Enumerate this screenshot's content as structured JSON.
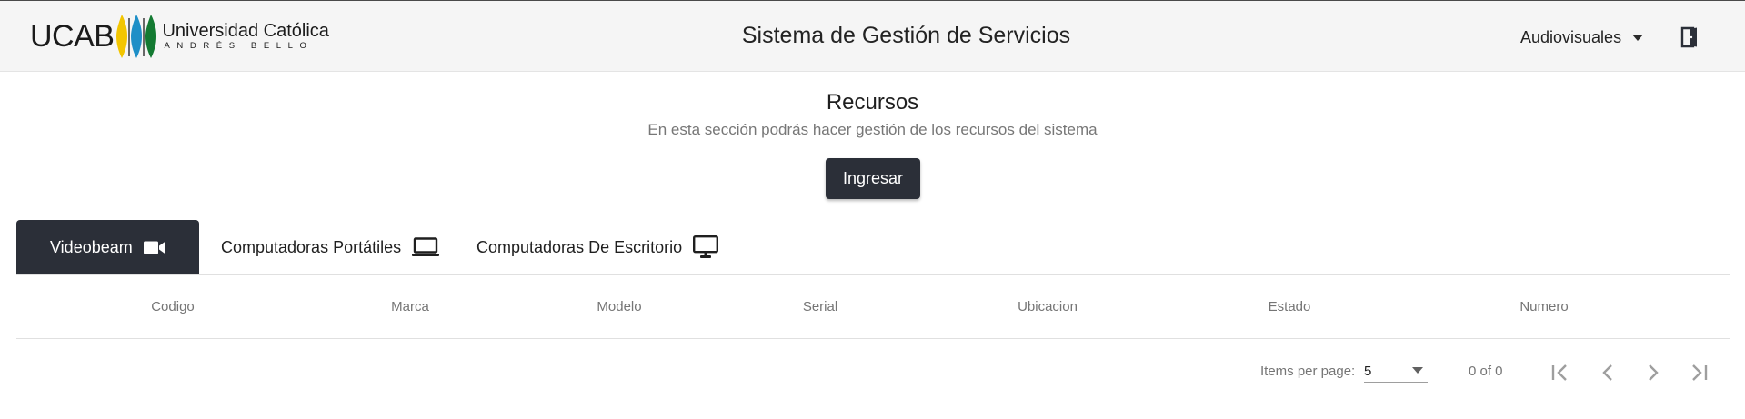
{
  "header": {
    "logo": {
      "mark": "UCAB",
      "name": "Universidad Católica",
      "subtitle": "ANDRÉS BELLO"
    },
    "title": "Sistema de Gestión de Servicios",
    "department_menu": {
      "label": "Audiovisuales",
      "icon": "caret-down-icon"
    },
    "logout_icon": "door-exit-icon"
  },
  "colors": {
    "header_bg": "#f5f5f5",
    "primary": "#2b2f38",
    "logo_yellow": "#f2c500",
    "logo_blue": "#1e8fc7",
    "logo_green": "#137a32"
  },
  "intro": {
    "title": "Recursos",
    "description": "En esta sección podrás hacer gestión de los recursos del sistema",
    "primary_button": "Ingresar"
  },
  "tabs": [
    {
      "label": "Videobeam",
      "icon": "video-camera-icon",
      "active": true
    },
    {
      "label": "Computadoras Portátiles",
      "icon": "laptop-icon",
      "active": false
    },
    {
      "label": "Computadoras De Escritorio",
      "icon": "desktop-monitor-icon",
      "active": false
    }
  ],
  "table": {
    "columns": [
      "Codigo",
      "Marca",
      "Modelo",
      "Serial",
      "Ubicacion",
      "Estado",
      "Numero"
    ],
    "rows": []
  },
  "paginator": {
    "items_per_page_label": "Items per page:",
    "page_size": "5",
    "range_label": "0 of 0",
    "buttons": [
      "first-page-icon",
      "previous-page-icon",
      "next-page-icon",
      "last-page-icon"
    ]
  }
}
